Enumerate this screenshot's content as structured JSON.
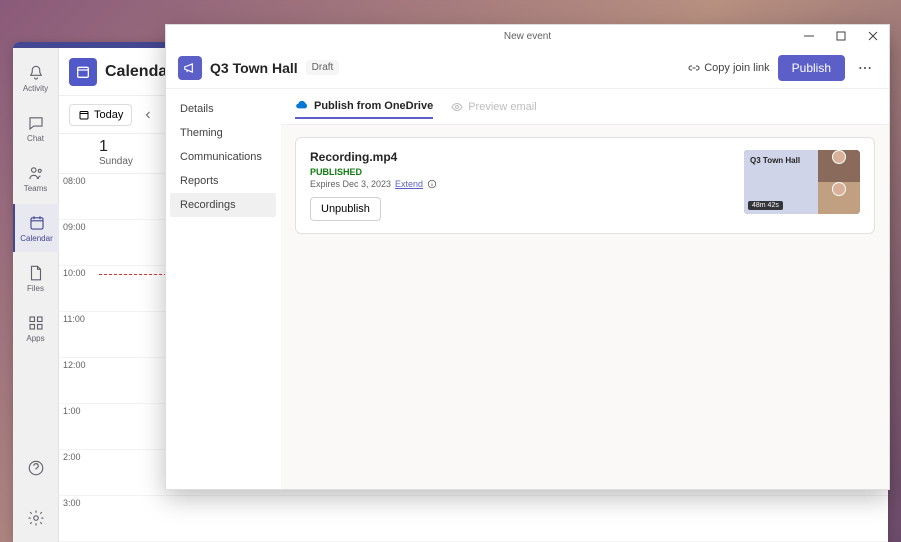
{
  "rail": {
    "items": [
      {
        "label": "Activity"
      },
      {
        "label": "Chat"
      },
      {
        "label": "Teams"
      },
      {
        "label": "Calendar"
      },
      {
        "label": "Files"
      },
      {
        "label": "Apps"
      }
    ]
  },
  "calendar": {
    "title": "Calendar",
    "today_label": "Today",
    "day_number": "1",
    "day_name": "Sunday",
    "times": [
      "08:00",
      "09:00",
      "10:00",
      "11:00",
      "12:00",
      "1:00",
      "2:00",
      "3:00"
    ]
  },
  "modal": {
    "window_title": "New event",
    "event_title": "Q3 Town Hall",
    "draft_label": "Draft",
    "copy_link_label": "Copy join link",
    "publish_label": "Publish",
    "sidebar": {
      "items": [
        {
          "label": "Details"
        },
        {
          "label": "Theming"
        },
        {
          "label": "Communications"
        },
        {
          "label": "Reports"
        },
        {
          "label": "Recordings"
        }
      ]
    },
    "tabs": {
      "publish_label": "Publish from OneDrive",
      "preview_label": "Preview email"
    },
    "recording": {
      "filename": "Recording.mp4",
      "status": "PUBLISHED",
      "expiry_prefix": "Expires Dec 3, 2023",
      "extend_label": "Extend",
      "unpublish_label": "Unpublish",
      "thumb_title": "Q3 Town Hall",
      "duration": "48m 42s"
    }
  }
}
